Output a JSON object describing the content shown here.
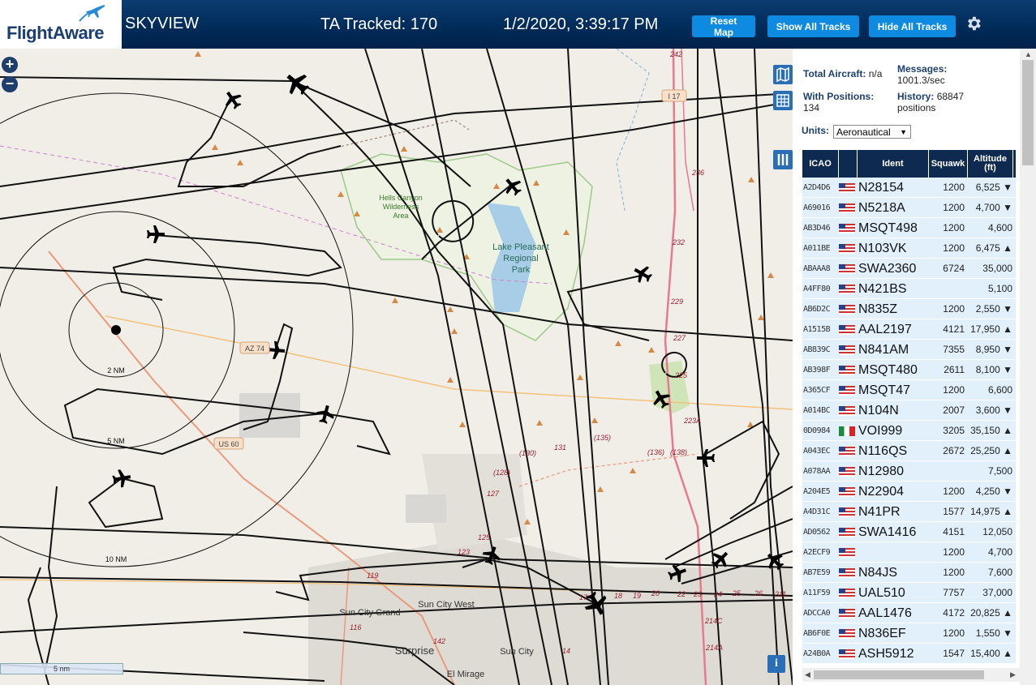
{
  "header": {
    "logo_text": "FlightAware",
    "app_title": "SKYVIEW",
    "tracked_label": "TA Tracked: 170",
    "datetime": "1/2/2020, 3:39:17 PM",
    "buttons": {
      "reset_map": "Reset Map",
      "show_all_tracks": "Show All Tracks",
      "hide_all_tracks": "Hide All Tracks"
    }
  },
  "map": {
    "zoom_in": "+",
    "zoom_out": "−",
    "info": "i",
    "scale_label": "5 nm",
    "range_rings": [
      "2 NM",
      "5 NM",
      "10 NM"
    ],
    "places": [
      "Hells Canyon",
      "Wilderness",
      "Area",
      "Lake Pleasant",
      "Regional",
      "Park",
      "Sun City Grand",
      "Sun City West",
      "Surprise",
      "Sun City",
      "El Mirage"
    ],
    "route_shields": [
      "AZ 74",
      "US 60",
      "I 17"
    ],
    "roadway_numbers": [
      "242",
      "236",
      "232",
      "229",
      "227",
      "225",
      "223A",
      "131",
      "(135)",
      "(136)",
      "(138)",
      "(130)",
      "(128)",
      "127",
      "125",
      "123",
      "119",
      "116",
      "142",
      "14",
      "17",
      "18",
      "19",
      "20",
      "22",
      "23",
      "24",
      "25",
      "26",
      "211",
      "214A",
      "214C"
    ]
  },
  "sidebar": {
    "total_aircraft_label": "Total Aircraft:",
    "total_aircraft_value": "n/a",
    "messages_label": "Messages:",
    "messages_value": "1001.3/sec",
    "with_positions_label": "With Positions:",
    "with_positions_value": "134",
    "history_label": "History:",
    "history_value": "68847",
    "history_unit": "positions",
    "units_label": "Units:",
    "units_value": "Aeronautical",
    "columns": {
      "icao": "ICAO",
      "ident": "Ident",
      "squawk": "Squawk",
      "altitude": "Altitude",
      "altitude_unit": "(ft)"
    },
    "rows": [
      {
        "icao": "A2D4D6",
        "flag": "us",
        "ident": "N28154",
        "squawk": "1200",
        "alt": "6,525 ▼"
      },
      {
        "icao": "A69016",
        "flag": "us",
        "ident": "N5218A",
        "squawk": "1200",
        "alt": "4,700 ▼"
      },
      {
        "icao": "AB3D46",
        "flag": "us",
        "ident": "MSQT498",
        "squawk": "1200",
        "alt": "4,600"
      },
      {
        "icao": "A011BE",
        "flag": "us",
        "ident": "N103VK",
        "squawk": "1200",
        "alt": "6,475 ▲"
      },
      {
        "icao": "ABAAA8",
        "flag": "us",
        "ident": "SWA2360",
        "squawk": "6724",
        "alt": "35,000"
      },
      {
        "icao": "A4FF80",
        "flag": "us",
        "ident": "N421BS",
        "squawk": "",
        "alt": "5,100"
      },
      {
        "icao": "AB6D2C",
        "flag": "us",
        "ident": "N835Z",
        "squawk": "1200",
        "alt": "2,550 ▼"
      },
      {
        "icao": "A1515B",
        "flag": "us",
        "ident": "AAL2197",
        "squawk": "4121",
        "alt": "17,950 ▲"
      },
      {
        "icao": "AB839C",
        "flag": "us",
        "ident": "N841AM",
        "squawk": "7355",
        "alt": "8,950 ▼"
      },
      {
        "icao": "AB398F",
        "flag": "us",
        "ident": "MSQT480",
        "squawk": "2611",
        "alt": "8,100 ▼"
      },
      {
        "icao": "A365CF",
        "flag": "us",
        "ident": "MSQT47",
        "squawk": "1200",
        "alt": "6,600"
      },
      {
        "icao": "A014BC",
        "flag": "us",
        "ident": "N104N",
        "squawk": "2007",
        "alt": "3,600 ▼"
      },
      {
        "icao": "0D0984",
        "flag": "mx",
        "ident": "VOI999",
        "squawk": "3205",
        "alt": "35,150 ▲"
      },
      {
        "icao": "A043EC",
        "flag": "us",
        "ident": "N116QS",
        "squawk": "2672",
        "alt": "25,250 ▲"
      },
      {
        "icao": "A078AA",
        "flag": "us",
        "ident": "N12980",
        "squawk": "",
        "alt": "7,500"
      },
      {
        "icao": "A204E5",
        "flag": "us",
        "ident": "N22904",
        "squawk": "1200",
        "alt": "4,250 ▼"
      },
      {
        "icao": "A4D31C",
        "flag": "us",
        "ident": "N41PR",
        "squawk": "1577",
        "alt": "14,975 ▲"
      },
      {
        "icao": "AD0562",
        "flag": "us",
        "ident": "SWA1416",
        "squawk": "4151",
        "alt": "12,050"
      },
      {
        "icao": "A2ECF9",
        "flag": "us",
        "ident": "",
        "squawk": "1200",
        "alt": "4,700"
      },
      {
        "icao": "AB7E59",
        "flag": "us",
        "ident": "N84JS",
        "squawk": "1200",
        "alt": "7,600"
      },
      {
        "icao": "A11F59",
        "flag": "us",
        "ident": "UAL510",
        "squawk": "7757",
        "alt": "37,000"
      },
      {
        "icao": "ADCCA0",
        "flag": "us",
        "ident": "AAL1476",
        "squawk": "4172",
        "alt": "20,825 ▲"
      },
      {
        "icao": "AB6F0E",
        "flag": "us",
        "ident": "N836EF",
        "squawk": "1200",
        "alt": "1,550 ▼"
      },
      {
        "icao": "A24B0A",
        "flag": "us",
        "ident": "ASH5912",
        "squawk": "1547",
        "alt": "15,400 ▲"
      }
    ]
  }
}
